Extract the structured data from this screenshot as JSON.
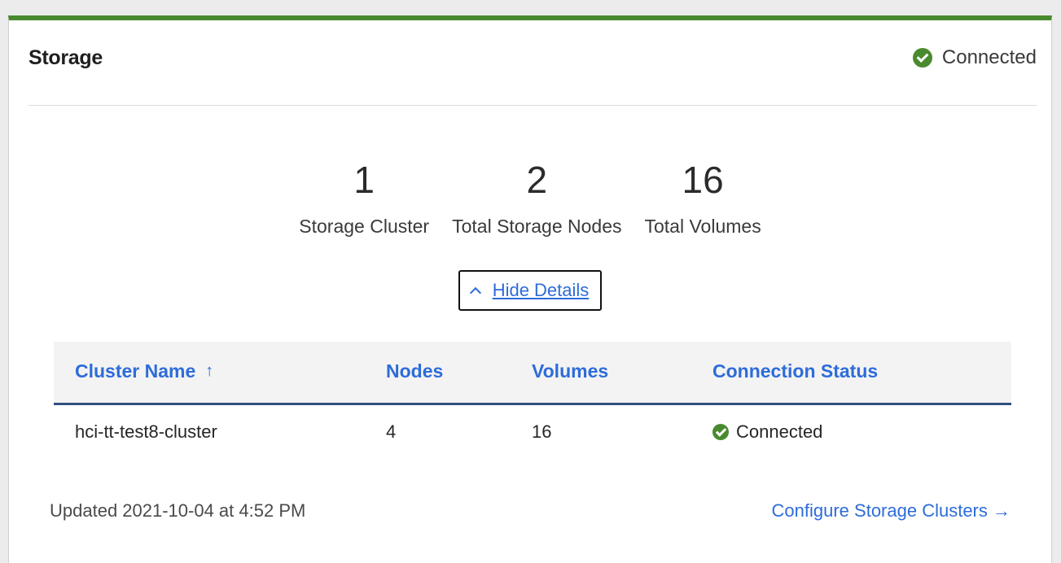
{
  "card": {
    "title": "Storage",
    "status_label": "Connected",
    "accent_color": "#4a8a2e",
    "status_icon": "check-circle-icon"
  },
  "stats": [
    {
      "value": "1",
      "label": "Storage Cluster"
    },
    {
      "value": "2",
      "label": "Total Storage Nodes"
    },
    {
      "value": "16",
      "label": "Total Volumes"
    }
  ],
  "toggle": {
    "label": "Hide Details",
    "icon": "chevron-up-icon"
  },
  "table": {
    "headers": {
      "cluster_name": "Cluster Name",
      "nodes": "Nodes",
      "volumes": "Volumes",
      "connection_status": "Connection Status"
    },
    "sort_indicator": "↑",
    "rows": [
      {
        "cluster_name": "hci-tt-test8-cluster",
        "nodes": "4",
        "volumes": "16",
        "connection_status": "Connected"
      }
    ]
  },
  "footer": {
    "updated": "Updated 2021-10-04 at 4:52 PM",
    "configure_link": "Configure Storage Clusters →"
  }
}
